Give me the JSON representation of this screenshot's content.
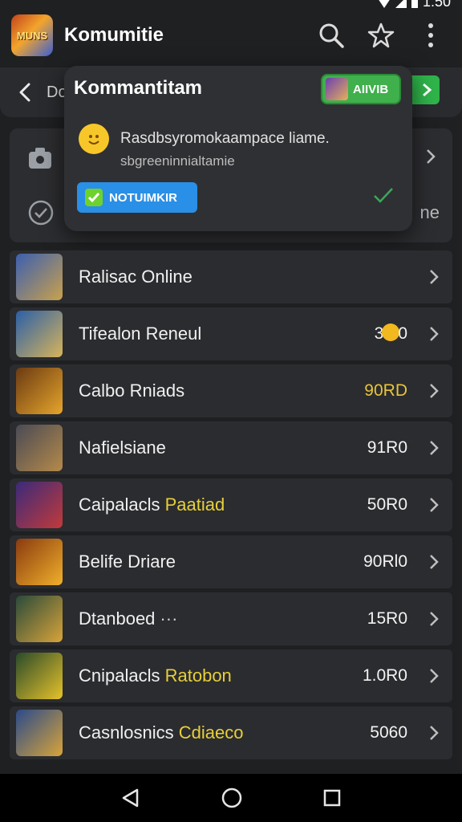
{
  "status_bar": {
    "time": "1:50"
  },
  "app_bar": {
    "logo_text": "MUNS",
    "title": "Komumitie",
    "icons": [
      "search-icon",
      "star-icon",
      "more-vert-icon"
    ]
  },
  "sub_bar": {
    "back_icon": "back-arrow-icon",
    "label": "Do"
  },
  "background_card": {
    "trailing_text": "ne"
  },
  "popup": {
    "title": "Kommantitam",
    "badge_label": "AIIVIB",
    "line1": "Rasdbsyromokaampace liame.",
    "line2": "sbgreeninnialtamie",
    "button_label": "NOTUIMKIR"
  },
  "list": {
    "items": [
      {
        "title": "Ralisac Online",
        "accent": "",
        "value": "",
        "value_color": "#f2f2f2",
        "thumb": [
          "#3b5fb0",
          "#c9a14d"
        ]
      },
      {
        "title": "Tifealon Reneul",
        "accent": "",
        "value": "3",
        "value_suffix": "0",
        "coin": true,
        "value_color": "#f2f2f2",
        "thumb": [
          "#2a5fa8",
          "#d8b45a"
        ]
      },
      {
        "title": "Calbo Rniads",
        "accent": "",
        "value": "90RD",
        "value_color": "#e9c43a",
        "thumb": [
          "#6a3a12",
          "#e6a52c"
        ]
      },
      {
        "title": "Nafielsiane",
        "accent": "",
        "value": "91R0",
        "value_color": "#f2f2f2",
        "thumb": [
          "#4a4a55",
          "#b58a4a"
        ]
      },
      {
        "title": "Caipalacls ",
        "accent": "Paatiad",
        "value": "50R0",
        "value_color": "#f2f2f2",
        "thumb": [
          "#3a2a7a",
          "#c23a3a"
        ]
      },
      {
        "title": "Belife Driare",
        "accent": "",
        "value": "90Rl0",
        "value_color": "#f2f2f2",
        "thumb": [
          "#8a3a10",
          "#f0b02a"
        ]
      },
      {
        "title": "Dtanboed",
        "accent": "",
        "dots": "···",
        "value": "15R0",
        "value_color": "#f2f2f2",
        "thumb": [
          "#2a4a3a",
          "#d8a43a"
        ]
      },
      {
        "title": "Cnipalacls ",
        "accent": "Ratobon",
        "value": "1.0R0",
        "value_color": "#f2f2f2",
        "thumb": [
          "#2a4a2a",
          "#e6c22a"
        ]
      },
      {
        "title": "Casnlosnics ",
        "accent": "Cdiaeco",
        "value": "5060",
        "value_color": "#f2f2f2",
        "thumb": [
          "#2a4a8a",
          "#d8a43a"
        ]
      }
    ]
  },
  "nav_bar": {
    "icons": [
      "back-triangle-icon",
      "home-circle-icon",
      "recents-square-icon"
    ]
  }
}
